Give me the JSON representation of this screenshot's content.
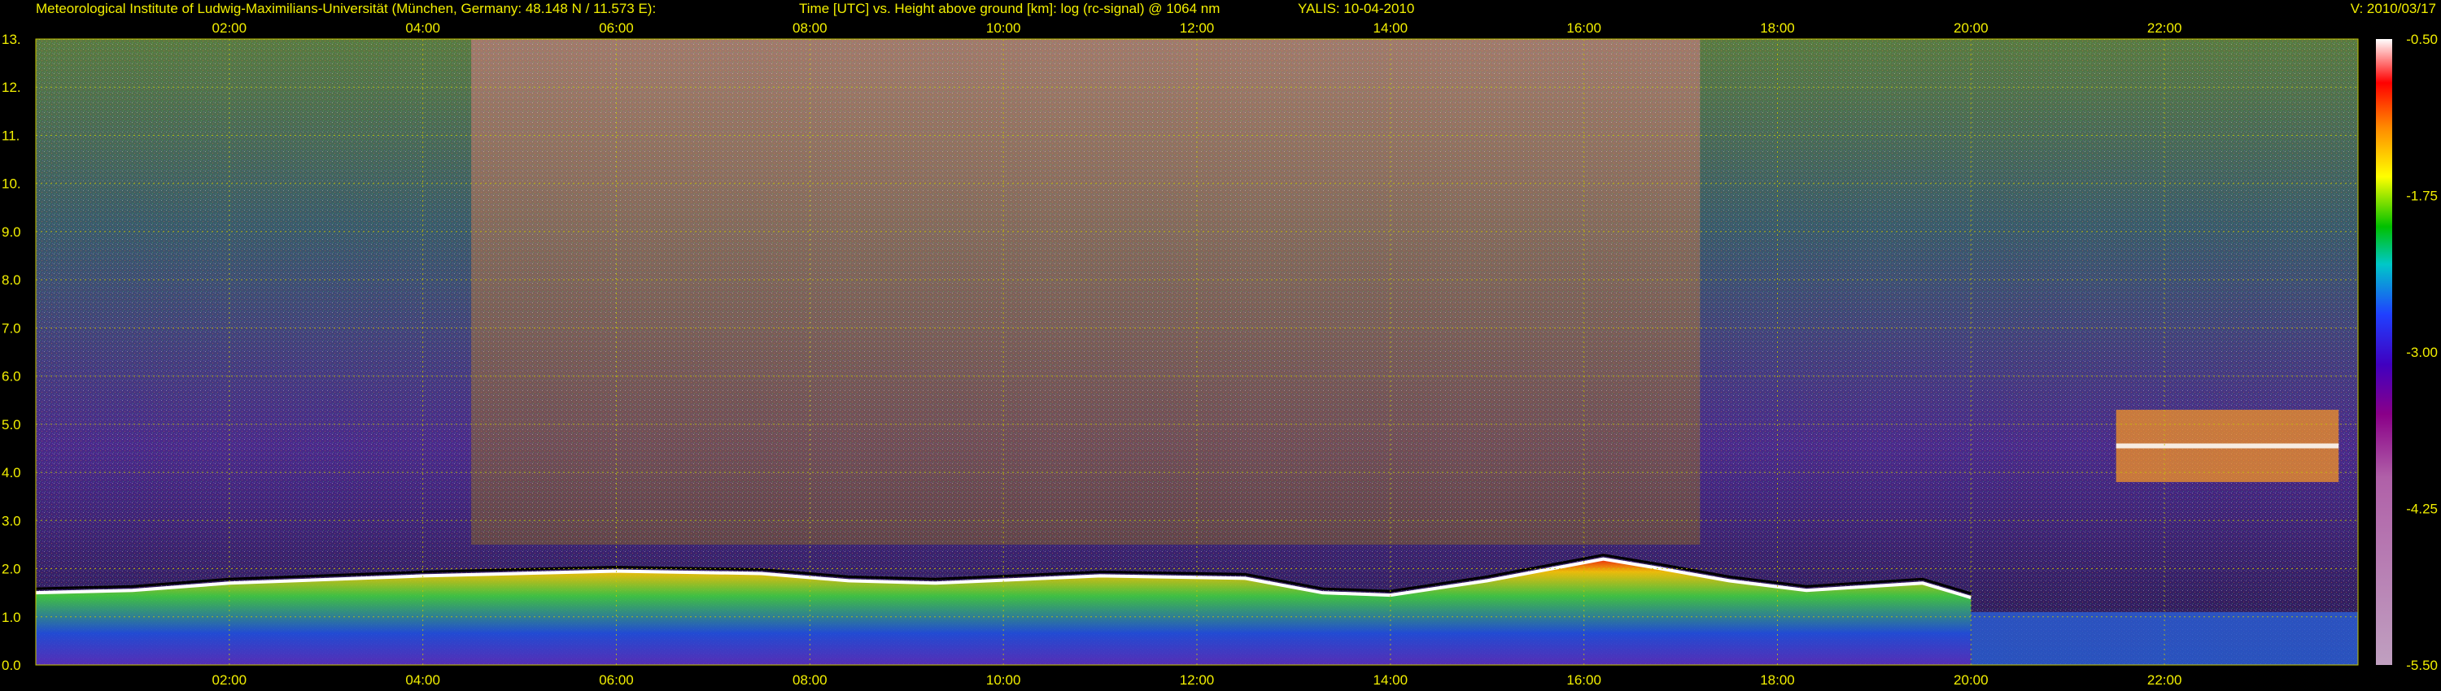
{
  "header": {
    "title": "Meteorological Institute of Ludwig-Maximilians-Universität (München, Germany: 48.148 N / 11.573 E):",
    "axes": "Time [UTC] vs. Height above ground [km]: log (rc-signal) @ 1064 nm",
    "instrument": "YALIS: 10-04-2010",
    "version": "V: 2010/03/17"
  },
  "colors": {
    "axis_text": "#f2ef00",
    "grid": "#c8c800",
    "background": "#000000"
  },
  "chart_data": {
    "type": "heatmap",
    "title": "Time [UTC] vs. Height above ground [km]: log (rc-signal) @ 1064 nm",
    "xlabel": "Time [UTC]",
    "ylabel": "Height above ground [km]",
    "xlim": [
      0.0,
      24.0
    ],
    "ylim": [
      0.0,
      13.0
    ],
    "x_ticks": [
      "02:00",
      "04:00",
      "06:00",
      "08:00",
      "10:00",
      "12:00",
      "14:00",
      "16:00",
      "18:00",
      "20:00",
      "22:00"
    ],
    "x_tick_values": [
      2,
      4,
      6,
      8,
      10,
      12,
      14,
      16,
      18,
      20,
      22
    ],
    "y_ticks": [
      "0.0",
      "1.0",
      "2.0",
      "3.0",
      "4.0",
      "5.0",
      "6.0",
      "7.0",
      "8.0",
      "9.0",
      "10.",
      "11.",
      "12.",
      "13."
    ],
    "y_tick_values": [
      0,
      1,
      2,
      3,
      4,
      5,
      6,
      7,
      8,
      9,
      10,
      11,
      12,
      13
    ],
    "colorbar": {
      "ticks": [
        "-0.50",
        "-1.75",
        "-3.00",
        "-4.25",
        "-5.50"
      ],
      "tick_values": [
        -0.5,
        -1.75,
        -3.0,
        -4.25,
        -5.5
      ],
      "range": [
        -5.5,
        -0.5
      ]
    },
    "boundary_layer_top_km": [
      {
        "time": 0.0,
        "height": 1.5
      },
      {
        "time": 1.0,
        "height": 1.55
      },
      {
        "time": 2.0,
        "height": 1.7
      },
      {
        "time": 4.0,
        "height": 1.85
      },
      {
        "time": 6.0,
        "height": 1.95
      },
      {
        "time": 7.5,
        "height": 1.9
      },
      {
        "time": 8.4,
        "height": 1.75
      },
      {
        "time": 9.3,
        "height": 1.7
      },
      {
        "time": 11.0,
        "height": 1.85
      },
      {
        "time": 12.5,
        "height": 1.8
      },
      {
        "time": 13.3,
        "height": 1.5
      },
      {
        "time": 14.0,
        "height": 1.45
      },
      {
        "time": 15.0,
        "height": 1.75
      },
      {
        "time": 16.2,
        "height": 2.2
      },
      {
        "time": 16.8,
        "height": 2.0
      },
      {
        "time": 17.5,
        "height": 1.75
      },
      {
        "time": 18.3,
        "height": 1.55
      },
      {
        "time": 19.5,
        "height": 1.7
      },
      {
        "time": 20.0,
        "height": 1.4
      }
    ],
    "cloud_layer": {
      "time_start": 21.5,
      "time_end": 23.8,
      "height_min": 3.8,
      "height_max": 5.3
    }
  }
}
